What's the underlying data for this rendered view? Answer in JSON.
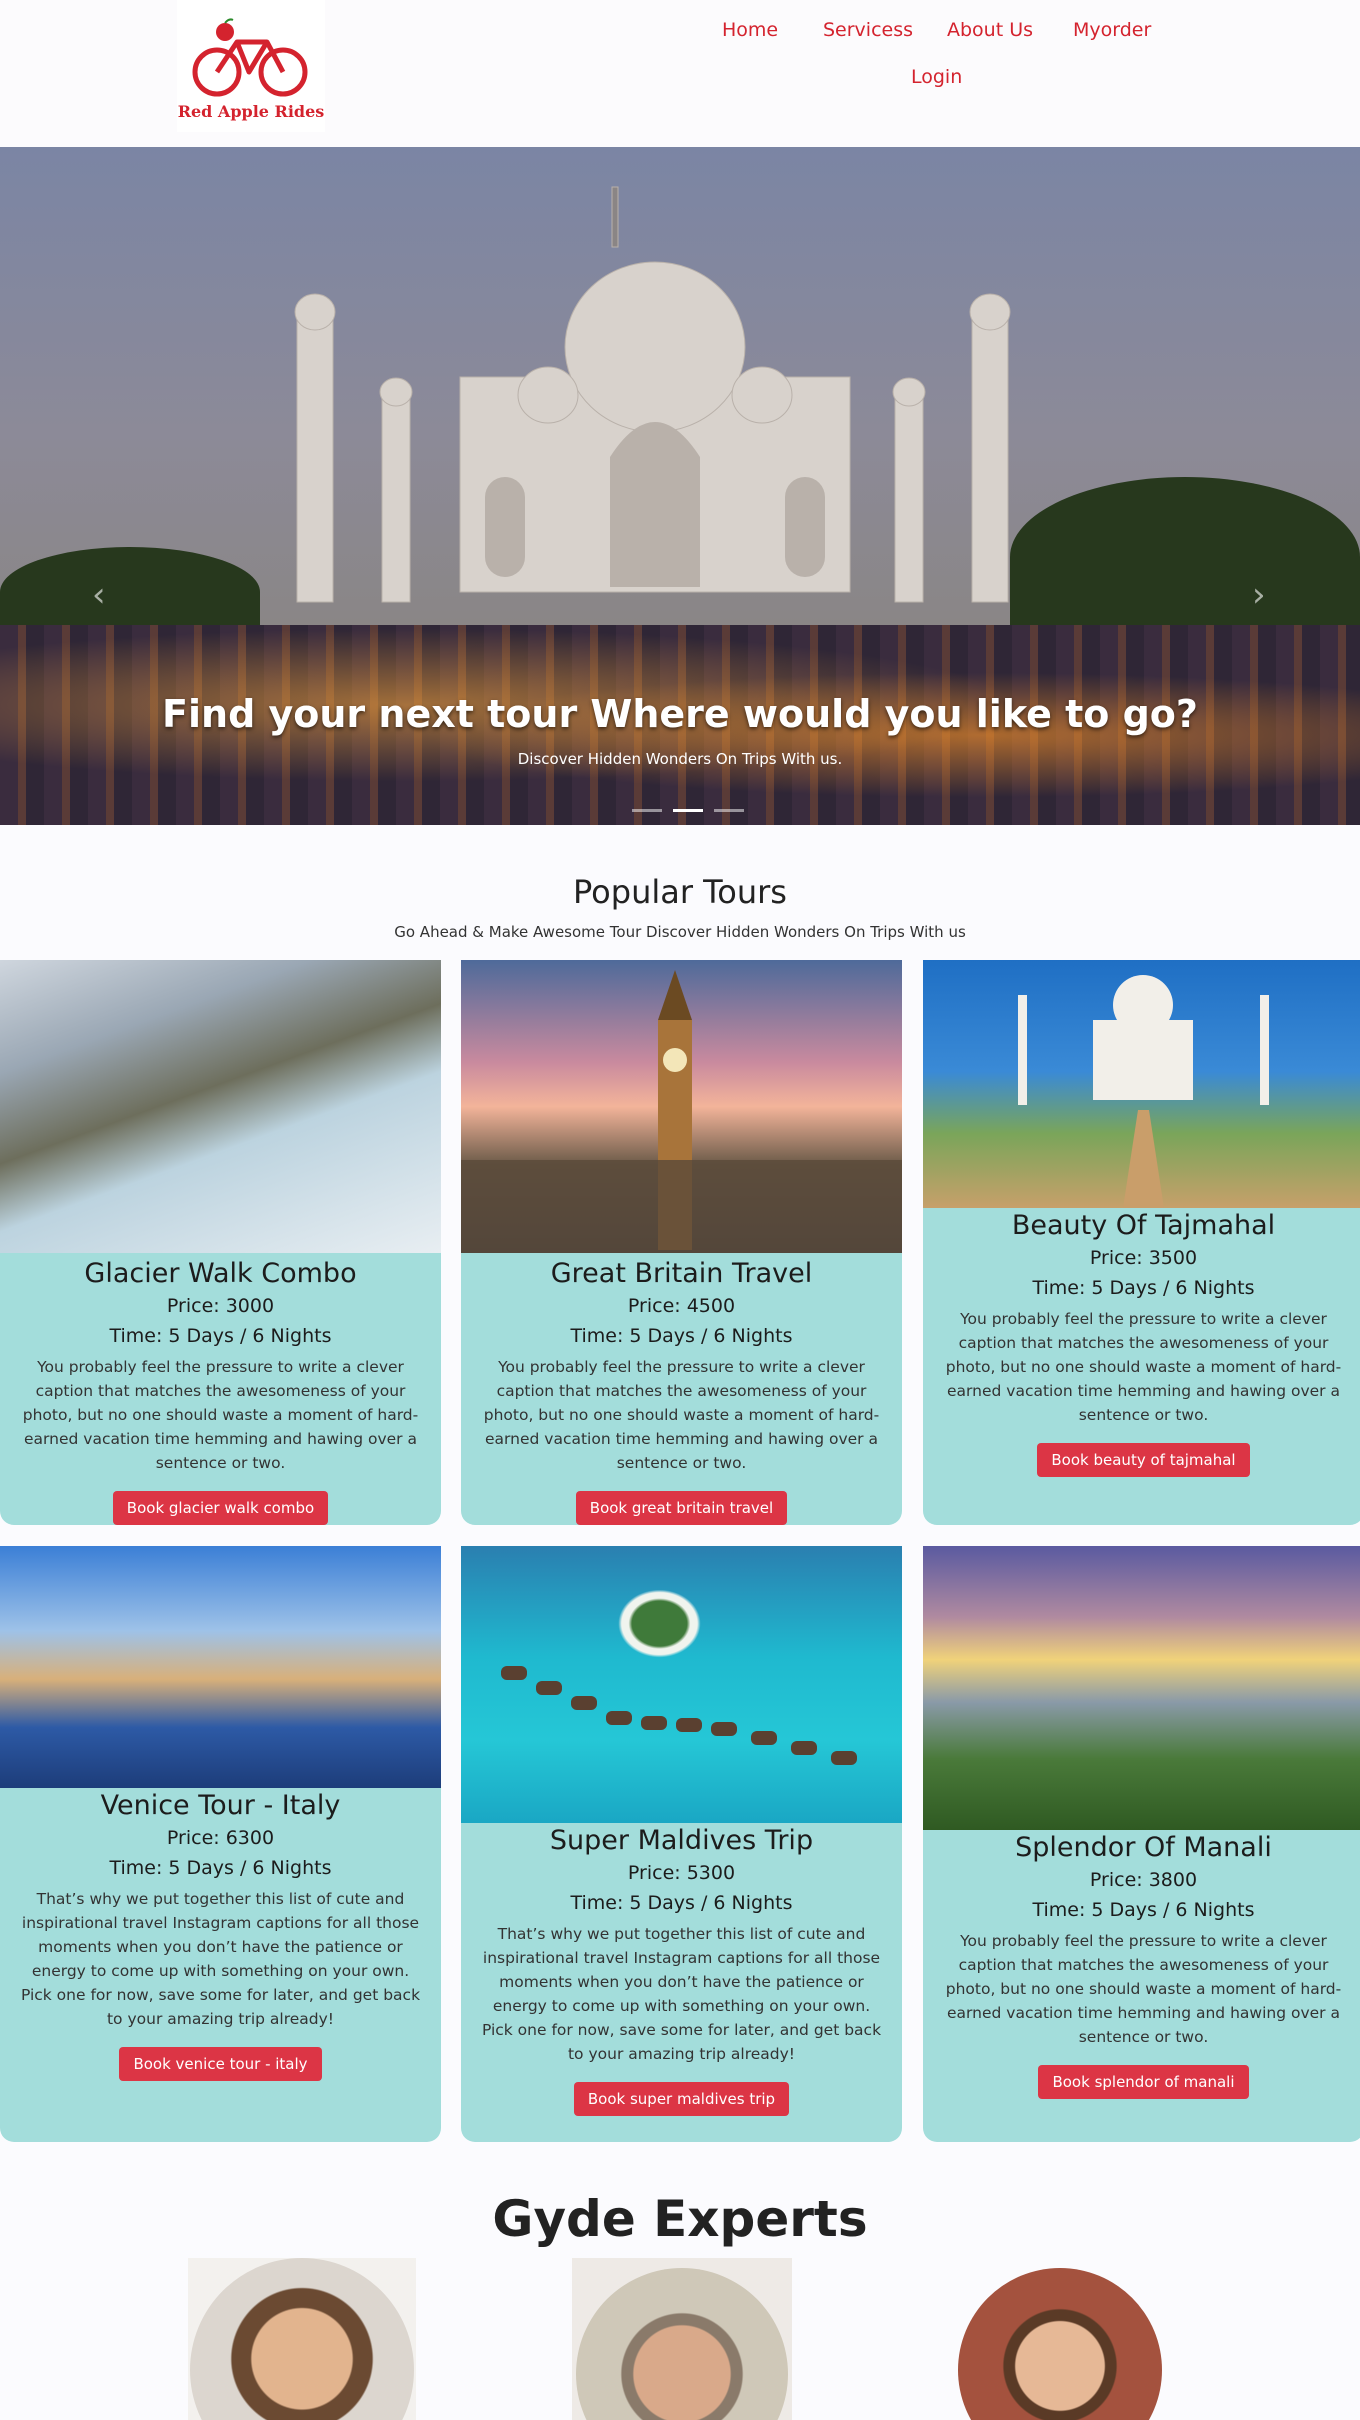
{
  "brand": {
    "logo_text": "Red Apple Rides",
    "color": "#d4232e"
  },
  "nav": {
    "home": "Home",
    "services": "Servicess",
    "about": "About Us",
    "myorder": "Myorder",
    "login": "Login"
  },
  "hero": {
    "title": "Find your next tour Where would you like to go?",
    "subtitle": "Discover Hidden Wonders On Trips With us.",
    "prev_icon": "chevron-left-icon",
    "next_icon": "chevron-right-icon",
    "slides": 3,
    "active_slide": 2
  },
  "popular": {
    "title": "Popular Tours",
    "subtitle": "Go Ahead & Make Awesome Tour Discover Hidden Wonders On Trips With us"
  },
  "tours": [
    {
      "name": "Glacier Walk Combo",
      "price": "Price: 3000",
      "time": "Time: 5 Days / 6 Nights",
      "desc": "You probably feel the pressure to write a clever caption that matches the awesomeness of your photo, but no one should waste a moment of hard-earned vacation time hemming and hawing over a sentence or two.",
      "button": "Book glacier walk combo"
    },
    {
      "name": "Great Britain Travel",
      "price": "Price: 4500",
      "time": "Time: 5 Days / 6 Nights",
      "desc": "You probably feel the pressure to write a clever caption that matches the awesomeness of your photo, but no one should waste a moment of hard-earned vacation time hemming and hawing over a sentence or two.",
      "button": "Book great britain travel"
    },
    {
      "name": "Beauty Of Tajmahal",
      "price": "Price: 3500",
      "time": "Time: 5 Days / 6 Nights",
      "desc": "You probably feel the pressure to write a clever caption that matches the awesomeness of your photo, but no one should waste a moment of hard-earned vacation time hemming and hawing over a sentence or two.",
      "button": "Book beauty of tajmahal"
    },
    {
      "name": "Venice Tour - Italy",
      "price": "Price: 6300",
      "time": "Time: 5 Days / 6 Nights",
      "desc": "That’s why we put together this list of cute and inspirational travel Instagram captions for all those moments when you don’t have the patience or energy to come up with something on your own. Pick one for now, save some for later, and get back to your amazing trip already!",
      "button": "Book venice tour - italy"
    },
    {
      "name": "Super Maldives Trip",
      "price": "Price: 5300",
      "time": "Time: 5 Days / 6 Nights",
      "desc": "That’s why we put together this list of cute and inspirational travel Instagram captions for all those moments when you don’t have the patience or energy to come up with something on your own. Pick one for now, save some for later, and get back to your amazing trip already!",
      "button": "Book super maldives trip"
    },
    {
      "name": "Splendor Of Manali",
      "price": "Price: 3800",
      "time": "Time: 5 Days / 6 Nights",
      "desc": "You probably feel the pressure to write a clever caption that matches the awesomeness of your photo, but no one should waste a moment of hard-earned vacation time hemming and hawing over a sentence or two.",
      "button": "Book splendor of manali"
    }
  ],
  "experts": {
    "title": "Gyde Experts"
  },
  "colors": {
    "card_bg": "#a3dddb",
    "button_bg": "#dc3545",
    "accent": "#d4232e"
  }
}
